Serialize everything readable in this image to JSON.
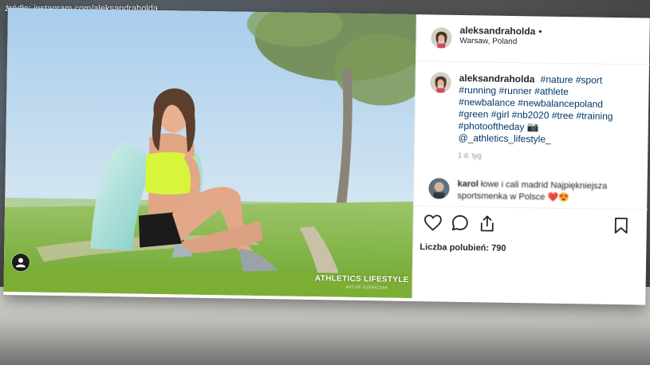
{
  "source_caption": "źródło: instagram.com/aleksandraholda",
  "post": {
    "username": "aleksandraholda",
    "follow_dot": "•",
    "location": "Warsaw, Poland",
    "caption_prefix": "",
    "hashtags": [
      "#nature",
      "#sport",
      "#running",
      "#runner",
      "#athlete",
      "#newbalance",
      "#newbalancepoland",
      "#green",
      "#girl",
      "#nb2020",
      "#tree",
      "#training",
      "#photooftheday"
    ],
    "camera_emoji": "📷",
    "mention": "@_athletics_lifestyle_",
    "caption_time": "1 d. tyg",
    "comment": {
      "username": "karol",
      "text": "łowe i cali madrid Najpiękniejsza sportsmenka w Polsce",
      "emojis": "❤️😍"
    },
    "likes_label": "Liczba polubień: 790",
    "photo_watermark": "ATHLETICS LIFESTYLE",
    "photo_watermark_sub": "ARTUR SZEWCZAK"
  },
  "icons": {
    "like": "heart-icon",
    "comment": "comment-icon",
    "share": "share-icon",
    "save": "bookmark-icon",
    "tagged_user": "user-icon"
  },
  "colors": {
    "text": "#262626",
    "hashtag": "#00376b",
    "muted": "#8e8e8e",
    "grass": "#8bbd3a",
    "sky": "#bcd8ef",
    "top_neon": "#d8f53c"
  }
}
